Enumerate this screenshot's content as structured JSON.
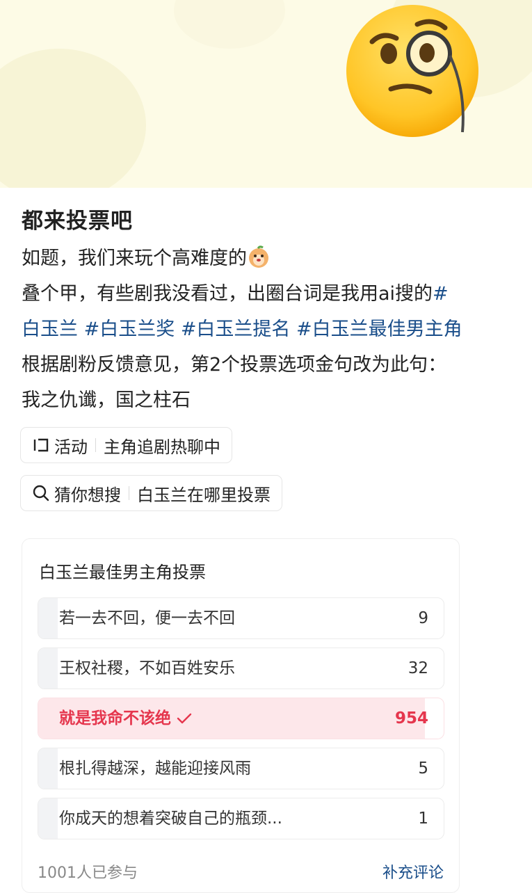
{
  "post": {
    "title": "都来投票吧",
    "lines": [
      "如题，我们来玩个高难度的",
      "叠个甲，有些剧我没看过，出圈台词是我用ai搜的",
      "根据剧粉反馈意见，第2个投票选项金句改为此句：",
      "我之仇谶，国之柱石"
    ],
    "hashtag_first": "#",
    "hashtags_line": [
      "白玉兰",
      "#白玉兰奖",
      "#白玉兰提名",
      "#白玉兰最佳男主角"
    ]
  },
  "activity": {
    "icon": "activity-icon",
    "label": "活动",
    "value": "主角追剧热聊中"
  },
  "search_suggest": {
    "icon": "search-icon",
    "label": "猜你想搜",
    "value": "白玉兰在哪里投票"
  },
  "poll": {
    "title": "白玉兰最佳男主角投票",
    "options": [
      {
        "label": "若一去不回，便一去不回",
        "count": "9",
        "share": 0.009,
        "selected": false
      },
      {
        "label": "王权社稷，不如百姓安乐",
        "count": "32",
        "share": 0.032,
        "selected": false
      },
      {
        "label": "就是我命不该绝",
        "count": "954",
        "share": 0.953,
        "selected": true
      },
      {
        "label": "根扎得越深，越能迎接风雨",
        "count": "5",
        "share": 0.005,
        "selected": false
      },
      {
        "label": "你成天的想着突破自己的瓶颈...",
        "count": "1",
        "share": 0.001,
        "selected": false
      }
    ],
    "participants": "1001人已参与",
    "supplement_label": "补充评论"
  },
  "colors": {
    "link": "#1a4e8a",
    "selected": "#e5364d",
    "banner": "#fdfbe6"
  }
}
